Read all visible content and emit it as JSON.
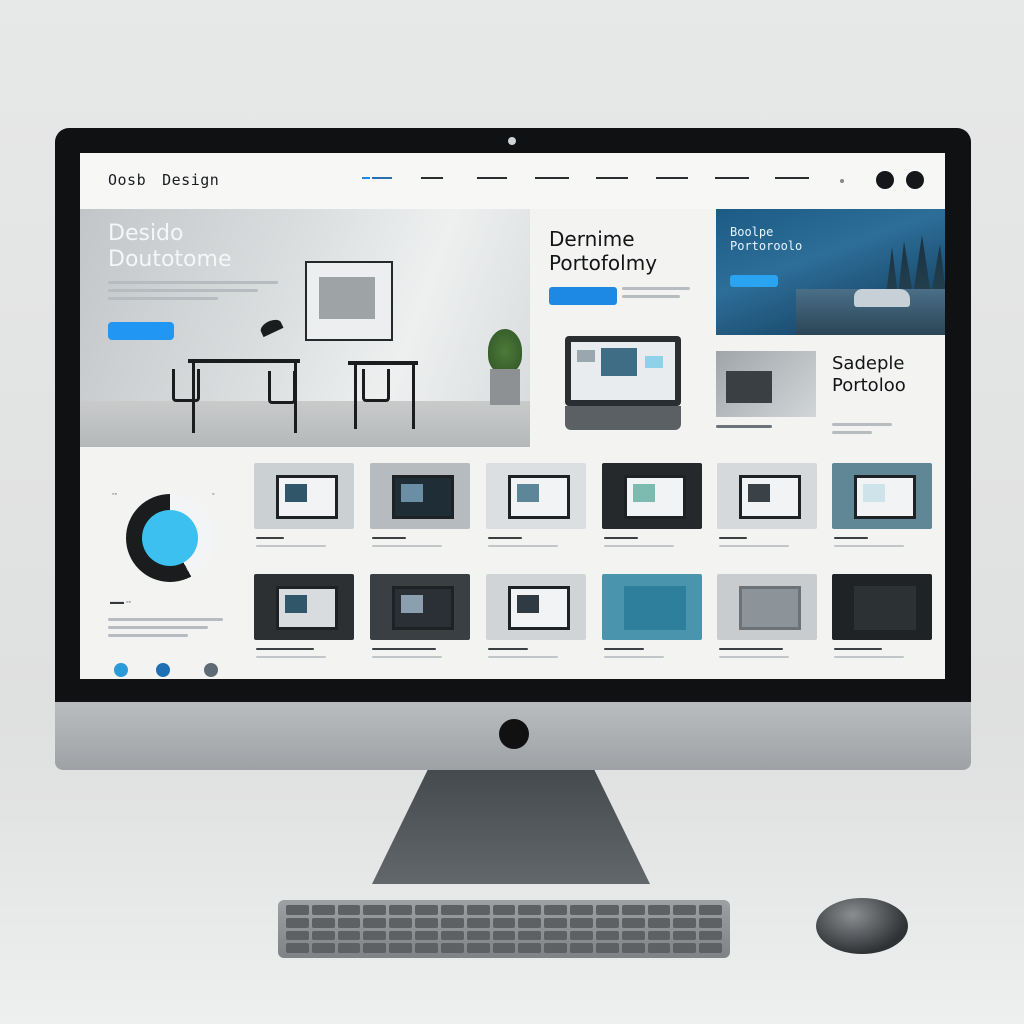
{
  "page": {
    "brand": {
      "left": "Oosb",
      "right": "Design"
    },
    "nav": {
      "links": [
        "",
        "",
        "",
        "",
        "",
        "",
        "",
        ""
      ],
      "accent": "#1e88e5"
    },
    "hero": {
      "title_line1": "Desido",
      "title_line2": "Doutotome",
      "cta_color": "#2196f3"
    },
    "middle": {
      "title_line1": "Dernime",
      "title_line2": "Portofolmy"
    },
    "banner": {
      "title_line1": "Boolpe",
      "title_line2": "Portoroolo"
    },
    "sample": {
      "title_line1": "Sadeple",
      "title_line2": "Portoloo"
    },
    "colors": {
      "brand_blue": "#1e88e5",
      "cyan": "#3cc0ef",
      "screen_bg": "#f3f3f1",
      "bezel": "#0f1113"
    },
    "icons": [
      "profile-circle-icon",
      "settings-circle-icon",
      "donut-chart-icon",
      "social-dot-icon"
    ]
  }
}
